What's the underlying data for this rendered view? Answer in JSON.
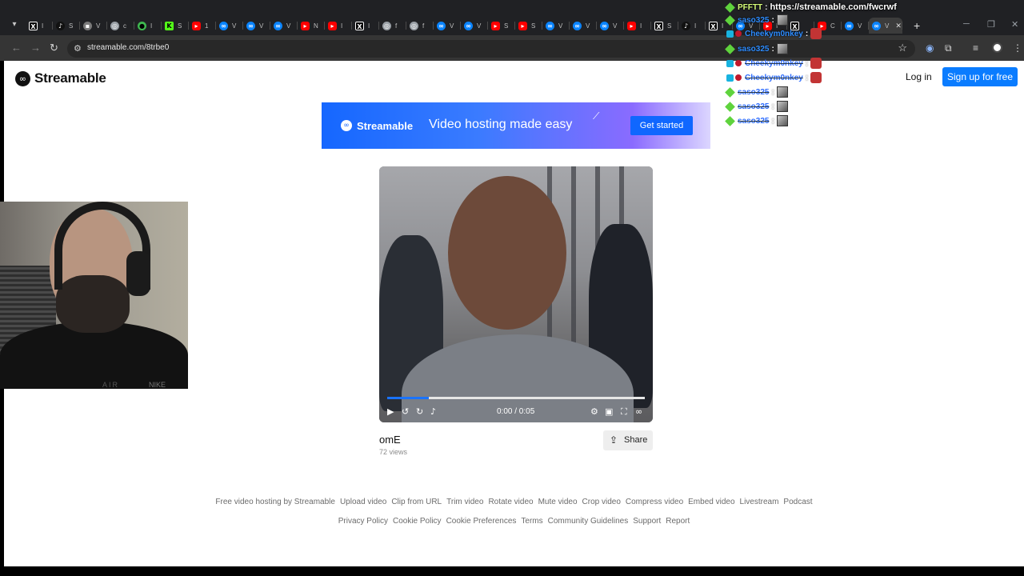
{
  "browser": {
    "tabs": [
      {
        "icon": "x-logo",
        "label": "I"
      },
      {
        "icon": "tiktok-logo",
        "label": "S"
      },
      {
        "icon": "grey-favicon",
        "label": "V"
      },
      {
        "icon": "chrome-logo",
        "label": "c"
      },
      {
        "icon": "green-favicon",
        "label": "I"
      },
      {
        "icon": "kick-logo",
        "label": "S"
      },
      {
        "icon": "youtube-logo",
        "label": "1"
      },
      {
        "icon": "streamable-logo",
        "label": "V"
      },
      {
        "icon": "streamable-logo",
        "label": "V"
      },
      {
        "icon": "streamable-logo",
        "label": "V"
      },
      {
        "icon": "youtube-logo",
        "label": "N"
      },
      {
        "icon": "youtube-logo",
        "label": "I"
      },
      {
        "icon": "x-logo",
        "label": "I"
      },
      {
        "icon": "chrome-logo",
        "label": "f"
      },
      {
        "icon": "chrome-logo",
        "label": "f"
      },
      {
        "icon": "streamable-logo",
        "label": "V"
      },
      {
        "icon": "streamable-logo",
        "label": "V"
      },
      {
        "icon": "youtube-logo",
        "label": "S"
      },
      {
        "icon": "youtube-logo",
        "label": "S"
      },
      {
        "icon": "streamable-logo",
        "label": "V"
      },
      {
        "icon": "streamable-logo",
        "label": "V"
      },
      {
        "icon": "streamable-logo",
        "label": "V"
      },
      {
        "icon": "youtube-logo",
        "label": "I"
      },
      {
        "icon": "x-logo",
        "label": "S"
      },
      {
        "icon": "tiktok-logo",
        "label": "I"
      },
      {
        "icon": "x-logo",
        "label": "I"
      },
      {
        "icon": "streamable-logo",
        "label": "V"
      },
      {
        "icon": "youtube-logo",
        "label": "I"
      },
      {
        "icon": "x-logo",
        "label": ""
      },
      {
        "icon": "youtube-logo",
        "label": "C"
      },
      {
        "icon": "streamable-logo",
        "label": "V"
      },
      {
        "icon": "streamable-logo",
        "label": "V",
        "active": true
      }
    ],
    "url": "streamable.com/8trbe0"
  },
  "site": {
    "brand": "Streamable",
    "login": "Log in",
    "signup": "Sign up for free"
  },
  "banner": {
    "brand": "Streamable",
    "headline": "Video hosting made easy",
    "cta": "Get started"
  },
  "video": {
    "time": "0:00 / 0:05",
    "progress_buffered": 0.16,
    "title": "omE",
    "views": "72 views",
    "share": "Share"
  },
  "footer": {
    "row1": [
      "Free video hosting by Streamable",
      "Upload video",
      "Clip from URL",
      "Trim video",
      "Rotate video",
      "Mute video",
      "Crop video",
      "Compress video",
      "Embed video",
      "Livestream",
      "Podcast"
    ],
    "row2": [
      "Privacy Policy",
      "Cookie Policy",
      "Cookie Preferences",
      "Terms",
      "Community Guidelines",
      "Support",
      "Report"
    ]
  },
  "webcam": {
    "shirt_text_1": "AIR",
    "shirt_text_2": "NIKE"
  },
  "chat": [
    {
      "user": "PFFTT",
      "text": "https://streamable.com/fwcrwf",
      "badge": "green"
    },
    {
      "user": "saso325",
      "text": "",
      "badge": "green",
      "emote": "face"
    },
    {
      "user": "Cheekym0nkey",
      "text": "",
      "badge": "blue",
      "emote": "mask"
    },
    {
      "user": "saso325",
      "text": "",
      "badge": "green",
      "emote": "face"
    },
    {
      "user": "Cheekym0nkey",
      "text": "",
      "badge": "blue",
      "emote": "mask",
      "dim": true
    },
    {
      "user": "Cheekym0nkey",
      "text": "",
      "badge": "blue",
      "emote": "mask",
      "dim": true
    },
    {
      "user": "saso325",
      "text": "",
      "badge": "green",
      "emote": "face",
      "dim": true
    },
    {
      "user": "saso325",
      "text": "",
      "badge": "green",
      "emote": "face",
      "dim": true
    },
    {
      "user": "saso325",
      "text": "",
      "badge": "green",
      "emote": "face",
      "dim": true
    }
  ]
}
